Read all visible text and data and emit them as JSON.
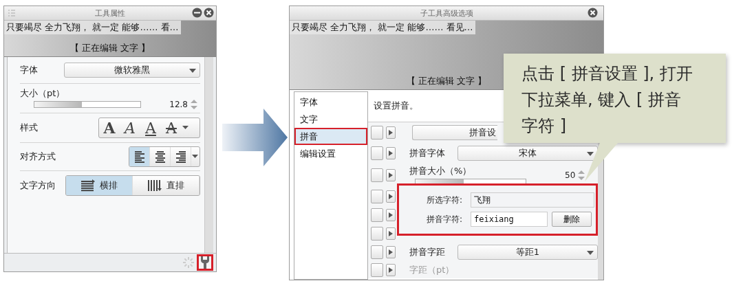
{
  "tool_panel": {
    "title": "工具属性",
    "preview": {
      "sample_text": "只要竭尽 全力飞翔， 就一定 能够…… 看…",
      "caption": "【 正在编辑 文字 】"
    },
    "font": {
      "label": "字体",
      "value": "微软雅黑"
    },
    "size": {
      "label": "大小（pt）",
      "level": 0.45,
      "value": "12.8"
    },
    "style": {
      "label": "样式",
      "buttons": [
        {
          "kind": "bold",
          "glyph": "A"
        },
        {
          "kind": "italic",
          "glyph": "A"
        },
        {
          "kind": "underline",
          "glyph": "A"
        },
        {
          "kind": "strike",
          "glyph": "A"
        }
      ]
    },
    "align": {
      "label": "对齐方式",
      "buttons": [
        {
          "kind": "left",
          "selected": true
        },
        {
          "kind": "center",
          "selected": false
        },
        {
          "kind": "right",
          "selected": false
        }
      ]
    },
    "direction": {
      "label": "文字方向",
      "options": [
        {
          "kind": "horizontal",
          "label": "横排",
          "selected": true
        },
        {
          "kind": "vertical",
          "label": "直排",
          "selected": false
        }
      ]
    },
    "settings_highlighted": true
  },
  "advanced_panel": {
    "title": "子工具高级选项",
    "preview": {
      "sample_text": "只要竭尽 全力飞翔， 就一定 能够…… 看见…",
      "caption": "【 正在编辑 文字 】"
    },
    "categories": [
      {
        "label": "字体",
        "selected": false,
        "highlighted": false
      },
      {
        "label": "文字",
        "selected": false,
        "highlighted": false
      },
      {
        "label": "拼音",
        "selected": true,
        "highlighted": true
      },
      {
        "label": "编辑设置",
        "selected": false,
        "highlighted": false
      }
    ],
    "heading": "设置拼音。",
    "row_checkboxes": [
      {
        "checked": false
      },
      {
        "checked": false
      },
      {
        "checked": false
      },
      {
        "checked": false
      },
      {
        "checked": false
      },
      {
        "checked": false
      },
      {
        "checked": false
      },
      {
        "checked": false
      }
    ],
    "setting_button": "拼音设",
    "ruby_font": {
      "label": "拼音字体",
      "value": "宋体"
    },
    "ruby_size": {
      "label": "拼音大小（%）",
      "level": 0.44,
      "value": "50"
    },
    "ruby_spacing": {
      "label": "拼音字距",
      "value": "等距1"
    },
    "spacing_pt": {
      "label": "字距（pt）",
      "disabled": true
    },
    "ruby_popup": {
      "highlighted": true,
      "selected_chars": {
        "label": "所选字符:",
        "value": "飞翔"
      },
      "ruby_chars": {
        "label": "拼音字符:",
        "value": "feixiang"
      },
      "delete_button": "删除"
    }
  },
  "callout": {
    "text": "点击 [ 拼音设置 ], 打开下拉菜单, 键入 [ 拼音字符 ]"
  }
}
